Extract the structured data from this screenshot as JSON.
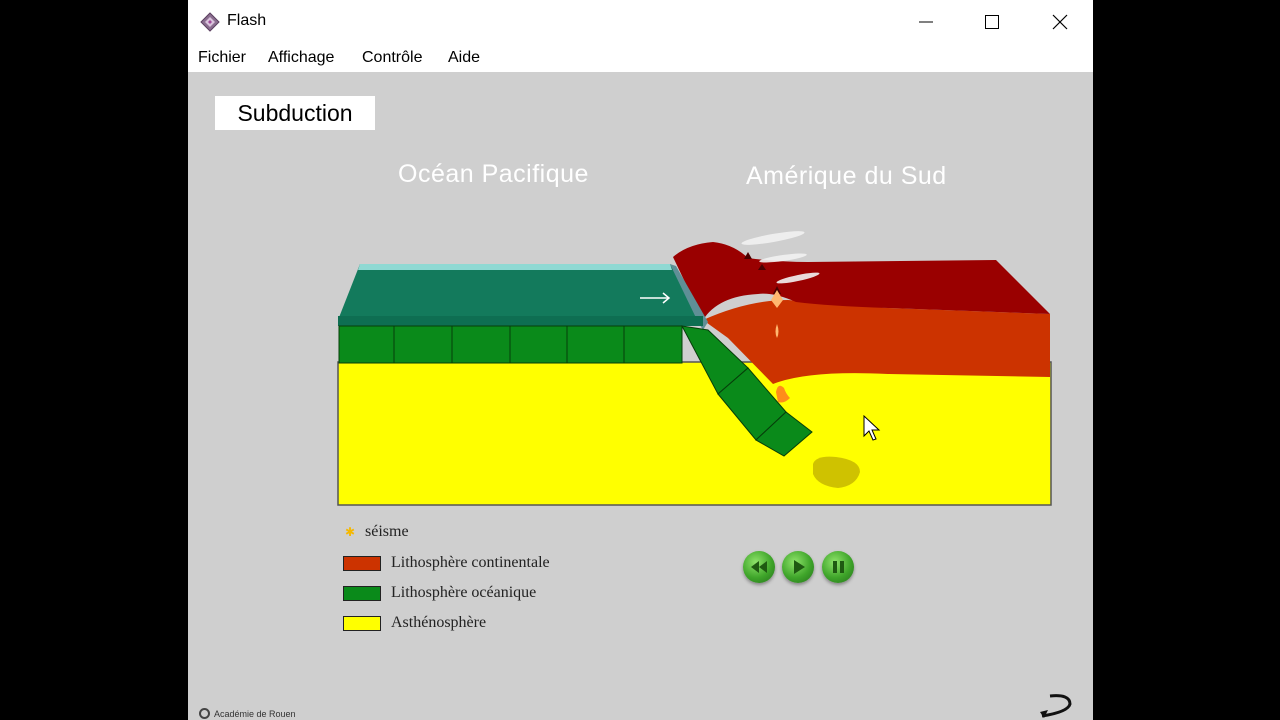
{
  "window": {
    "title": "Flash",
    "app_icon": "flash-player-icon"
  },
  "titlebar_buttons": {
    "minimize": "minimize-icon",
    "maximize": "maximize-icon",
    "close": "close-icon"
  },
  "menu": {
    "items": [
      "Fichier",
      "Affichage",
      "Contrôle",
      "Aide"
    ]
  },
  "stage": {
    "title": "Subduction",
    "regions": {
      "left": "Océan Pacifique",
      "right": "Amérique du Sud"
    },
    "legend": [
      {
        "label": "séisme",
        "symbol": "star-icon",
        "color": "#f5b800"
      },
      {
        "label": "Lithosphère continentale",
        "color": "#cc3300"
      },
      {
        "label": "Lithosphère océanique",
        "color": "#0a8a1a"
      },
      {
        "label": "Asthénosphère",
        "color": "#ffff00"
      }
    ],
    "controls": [
      "rewind-icon",
      "play-icon",
      "pause-icon"
    ],
    "credit": "Académie de Rouen"
  },
  "colors": {
    "stage_background": "#cfcfcf",
    "ocean": "#137a5c",
    "continental_top": "#9a0000",
    "continental": "#cc3300",
    "oceanic_lithosphere": "#0a8a1a",
    "asthenosphere": "#ffff00"
  }
}
